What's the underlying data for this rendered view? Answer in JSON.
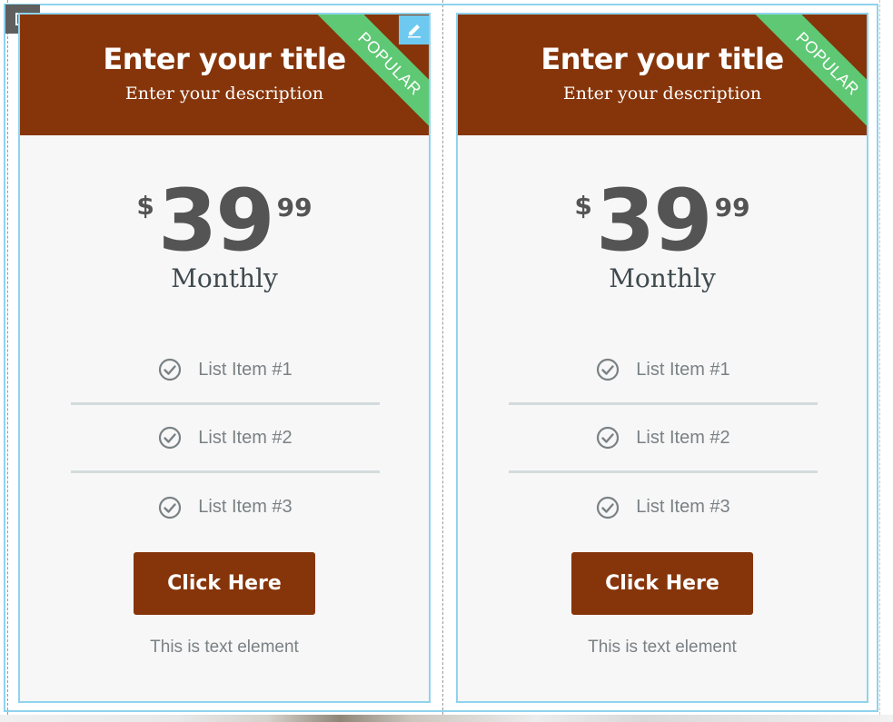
{
  "cards": [
    {
      "title": "Enter your title",
      "description": "Enter your description",
      "ribbon": "POPULAR",
      "currency": "$",
      "amount": "39",
      "cents": "99",
      "period": "Monthly",
      "features": [
        "List Item #1",
        "List Item #2",
        "List Item #3"
      ],
      "button_label": "Click Here",
      "footer_text": "This is text element"
    },
    {
      "title": "Enter your title",
      "description": "Enter your description",
      "ribbon": "POPULAR",
      "currency": "$",
      "amount": "39",
      "cents": "99",
      "period": "Monthly",
      "features": [
        "List Item #1",
        "List Item #2",
        "List Item #3"
      ],
      "button_label": "Click Here",
      "footer_text": "This is text element"
    }
  ],
  "colors": {
    "header_bg": "#86350a",
    "ribbon_bg": "#5ec874",
    "card_bg": "#f7f7f7",
    "selection_border": "#8fd3ee"
  },
  "icons": {
    "column_handle": "columns-icon",
    "edit": "pencil-icon",
    "feature": "check-circle-icon"
  }
}
